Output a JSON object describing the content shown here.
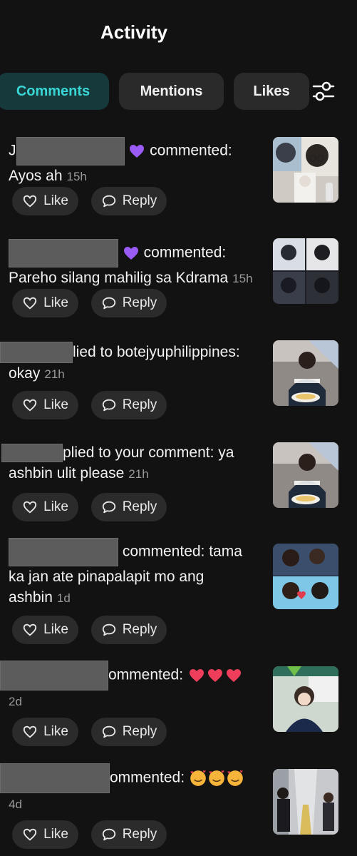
{
  "header": {
    "title": "Activity"
  },
  "tabs": [
    {
      "label": "Comments",
      "active": true
    },
    {
      "label": "Mentions",
      "active": false
    },
    {
      "label": "Likes",
      "active": false
    }
  ],
  "icons": {
    "filter": "sliders-icon",
    "like": "heart-outline-icon",
    "reply": "speech-bubble-icon"
  },
  "colors": {
    "background": "#121212",
    "accent": "#3ad5d5",
    "active_tab_bg": "#163a3b",
    "chip_bg": "#2b2b2b",
    "purple_heart": "#9b5cf6",
    "red_heart": "#ef3e5c"
  },
  "actions": {
    "like_label": "Like",
    "reply_label": "Reply"
  },
  "items": [
    {
      "prefix": "J",
      "text": " commented:",
      "line2": "Ayos ah",
      "time": "15h"
    },
    {
      "prefix": "",
      "text": " commented:",
      "line2": "Pareho silang mahilig sa Kdrama",
      "time": "15h"
    },
    {
      "prefix": "",
      "text": "lied to botejyuphilippines:",
      "line2": "okay",
      "time": "21h"
    },
    {
      "prefix": "",
      "text": "plied to your comment: ya",
      "line2": "ashbin ulit please",
      "time": "21h"
    },
    {
      "prefix": "",
      "text": " commented: tama",
      "line2": "ka jan ate pinapalapit mo ang",
      "line3": "ashbin",
      "time": "1d"
    },
    {
      "prefix": "",
      "text": "ommented: ",
      "line2": "",
      "time": "2d"
    },
    {
      "prefix": "",
      "text": "ommented: ",
      "line2": "",
      "time": "4d"
    }
  ]
}
